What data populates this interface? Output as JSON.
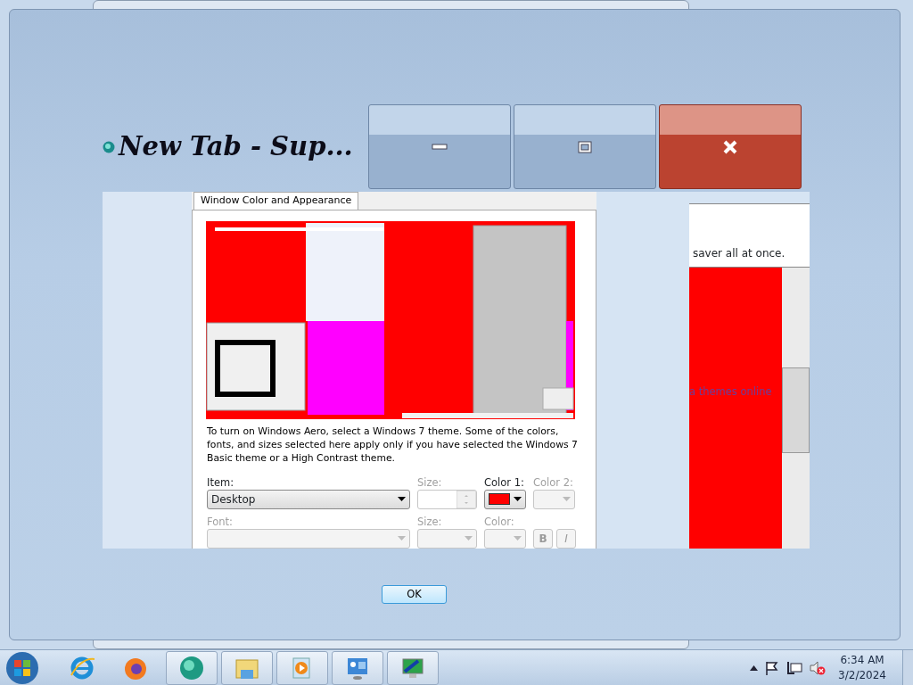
{
  "window": {
    "title": "New Tab - Sup...",
    "buttons": [
      {
        "kind": "minimize"
      },
      {
        "kind": "maximize"
      },
      {
        "kind": "close"
      }
    ]
  },
  "dialog": {
    "tab": {
      "label": "Window Color and Appearance",
      "selected": true
    },
    "note": "To turn on Windows Aero, select a Windows 7 theme.  Some of the colors, fonts, and sizes selected here apply only if you have selected the Windows 7 Basic theme or a High Contrast theme.",
    "rows": [
      {
        "fields": [
          {
            "kind": "dropdown",
            "label": "Item:",
            "value": "Desktop",
            "disabled": false
          },
          {
            "kind": "spinner",
            "label": "Size:",
            "disabled": true
          },
          {
            "kind": "color",
            "label": "Color 1:",
            "color": "#ff0000",
            "disabled": false
          },
          {
            "kind": "color",
            "label": "Color 2:",
            "disabled": true
          }
        ]
      },
      {
        "fields": [
          {
            "kind": "dropdown",
            "label": "Font:",
            "disabled": true
          },
          {
            "kind": "dropdown",
            "label": "Size:",
            "disabled": true
          },
          {
            "kind": "color",
            "label": "Color:",
            "disabled": true
          },
          {
            "kind": "styles",
            "buttons": [
              "B",
              "I"
            ],
            "disabled": true
          }
        ]
      }
    ]
  },
  "background_window": {
    "text": "saver all at once.",
    "link": "a themes online"
  },
  "ok_button": "OK",
  "taskbar": {
    "pinned": [
      {
        "kind": "ie"
      },
      {
        "kind": "firefox"
      }
    ],
    "tasks": [
      {
        "kind": "browser"
      },
      {
        "kind": "folder"
      },
      {
        "kind": "media"
      },
      {
        "kind": "control-panel"
      },
      {
        "kind": "display"
      }
    ],
    "clock": {
      "time": "6:34 AM",
      "date": "3/2/2024"
    }
  }
}
